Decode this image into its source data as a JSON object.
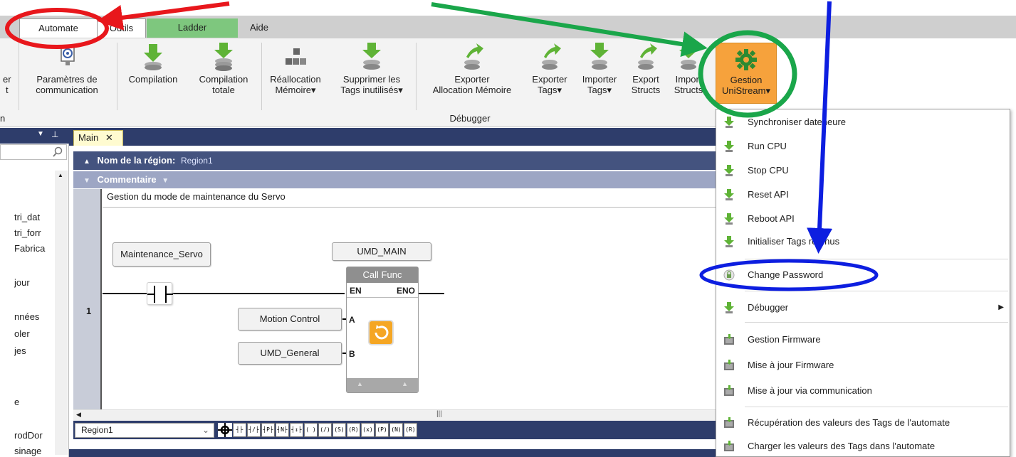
{
  "tabs": {
    "automate": "Automate",
    "outils": "Outils",
    "ladder": "Ladder",
    "aide": "Aide"
  },
  "ribbon": {
    "partial_left_line1": "er",
    "partial_left_line2": "t",
    "params_line1": "Paramètres de",
    "params_line2": "communication",
    "compilation": "Compilation",
    "compilation_totale_line1": "Compilation",
    "compilation_totale_line2": "totale",
    "reallocation_line1": "Réallocation",
    "reallocation_line2": "Mémoire",
    "supprimer_line1": "Supprimer les",
    "supprimer_line2": "Tags inutilisés",
    "exporter_alloc_line1": "Exporter",
    "exporter_alloc_line2": "Allocation Mémoire",
    "exporter_tags_line1": "Exporter",
    "exporter_tags_line2": "Tags",
    "importer_tags_line1": "Importer",
    "importer_tags_line2": "Tags",
    "export_structs_line1": "Export",
    "export_structs_line2": "Structs",
    "import_structs_line1": "Import",
    "import_structs_line2": "Structs",
    "gestion_line1": "Gestion",
    "gestion_line2": "UniStream",
    "group_left": "n",
    "group_debugger": "Débugger",
    "dropdown_marker": "▾"
  },
  "left_panel": {
    "items": [
      "tri_dat",
      "tri_forr",
      "Fabrica",
      "jour",
      "nnées",
      "oler",
      "jes",
      "e",
      "rodDor",
      "sinage"
    ]
  },
  "editor": {
    "doc_tab": "Main",
    "doc_tab_close": "✕",
    "region_label": "Nom de la région:",
    "region_name": "Region1",
    "comment_label": "Commentaire",
    "comment_text": "Gestion du mode de maintenance du Servo",
    "rung_number": "1",
    "contact_tag": "Maintenance_Servo",
    "func_name": "UMD_MAIN",
    "func_title": "Call Func",
    "en": "EN",
    "eno": "ENO",
    "input_a_tag": "Motion Control",
    "input_b_tag": "UMD_General",
    "pin_a": "A",
    "pin_b": "B",
    "region_select": "Region1"
  },
  "ladder_tools": [
    "┤├",
    "┤/├",
    "┤P├",
    "┤N├",
    "┤↕├",
    "( )",
    "(/)",
    "(S)",
    "(R)",
    "(x)",
    "(P)",
    "(N)",
    "(R)"
  ],
  "menu": {
    "items": [
      "Synchroniser dateheure",
      "Run CPU",
      "Stop CPU",
      "Reset API",
      "Reboot API",
      "Initialiser Tags retenus",
      "Change Password",
      "Débugger",
      "Gestion Firmware",
      "Mise à jour Firmware",
      "Mise à jour via communication",
      "Récupération des valeurs des Tags de l'automate",
      "Charger les valeurs des Tags dans l'automate"
    ],
    "submenu_arrow": "▶"
  },
  "colors": {
    "ladder_tab": "#7ec77e",
    "gestion_button": "#f6a23c",
    "annotation_red": "#e8171c",
    "annotation_green": "#1aa64a",
    "annotation_blue": "#0d1ee0",
    "nav_dark": "#2e3d6b"
  }
}
